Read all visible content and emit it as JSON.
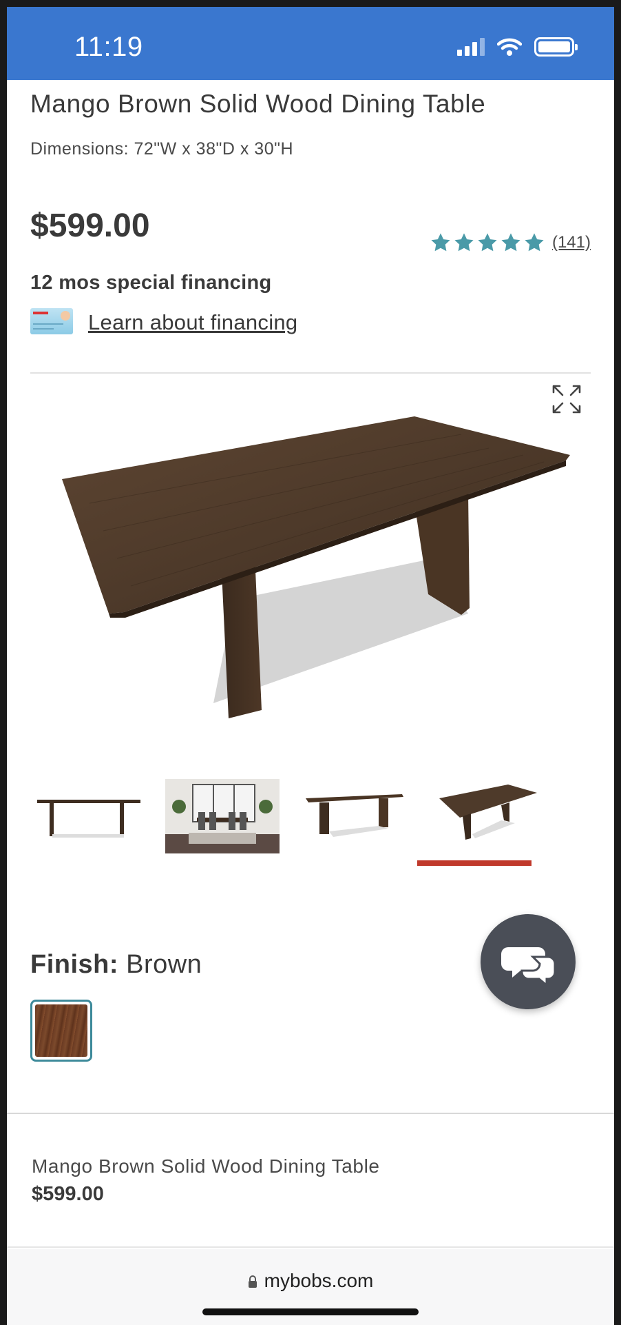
{
  "status_bar": {
    "time": "11:19",
    "background": "#3a77cf"
  },
  "product": {
    "title": "Mango Brown Solid Wood Dining Table",
    "dimensions": "Dimensions: 72\"W x 38\"D x 30\"H",
    "price": "$599.00",
    "rating": {
      "stars": 5,
      "count_label": "(141)",
      "star_color": "#4a9aa8"
    },
    "financing_heading": "12 mos special financing",
    "financing_link": "Learn about financing",
    "finish_label": "Finish:",
    "finish_value": "Brown"
  },
  "gallery": {
    "thumbnails": [
      {
        "name": "table-front-view"
      },
      {
        "name": "dining-room-scene"
      },
      {
        "name": "table-angle-view"
      },
      {
        "name": "table-top-angle-view"
      }
    ],
    "selected_index": 3,
    "accent": "#c0392b"
  },
  "sticky_footer": {
    "title": "Mango Brown Solid Wood Dining Table",
    "price": "$599.00"
  },
  "browser": {
    "url": "mybobs.com"
  },
  "icons": {
    "expand": "expand-icon",
    "chat": "chat-bubbles-icon",
    "lock": "lock-icon"
  }
}
